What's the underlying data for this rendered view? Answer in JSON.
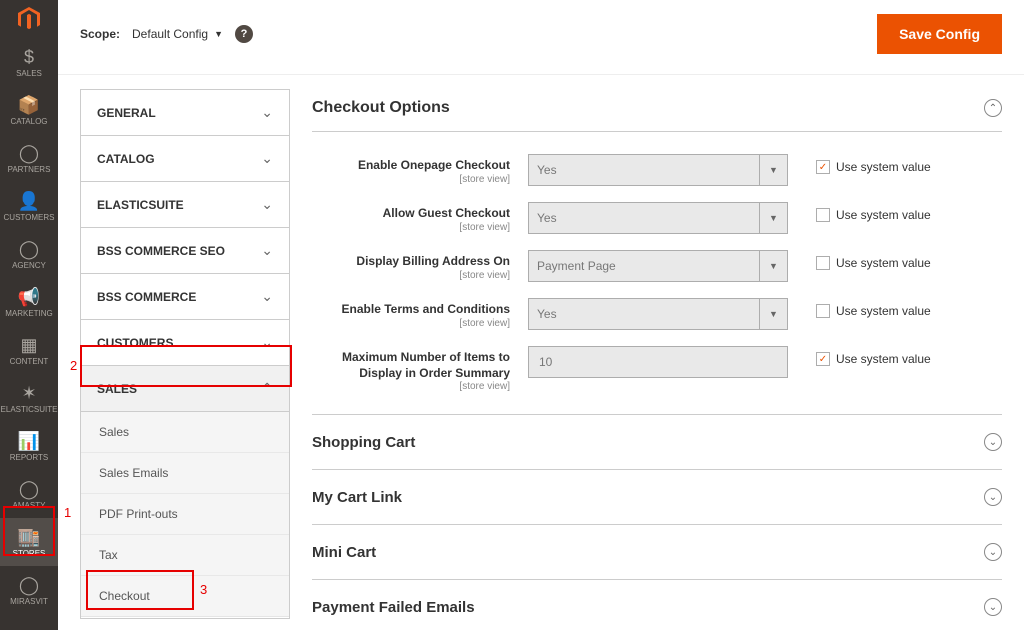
{
  "colors": {
    "accent": "#eb5202",
    "anno": "#e60000"
  },
  "sidebar": {
    "items": [
      {
        "icon": "$",
        "label": "SALES"
      },
      {
        "icon": "📦",
        "label": "CATALOG"
      },
      {
        "icon": "◯",
        "label": "PARTNERS"
      },
      {
        "icon": "👤",
        "label": "CUSTOMERS"
      },
      {
        "icon": "◯",
        "label": "AGENCY"
      },
      {
        "icon": "📢",
        "label": "MARKETING"
      },
      {
        "icon": "▦",
        "label": "CONTENT"
      },
      {
        "icon": "✶",
        "label": "ELASTICSUITE"
      },
      {
        "icon": "📊",
        "label": "REPORTS"
      },
      {
        "icon": "◯",
        "label": "AMASTY"
      },
      {
        "icon": "🏬",
        "label": "STORES"
      },
      {
        "icon": "◯",
        "label": "MIRASVIT"
      }
    ]
  },
  "topbar": {
    "scope_label": "Scope:",
    "scope_value": "Default Config",
    "help_symbol": "?",
    "save_label": "Save Config"
  },
  "nav_sections": [
    {
      "label": "GENERAL",
      "expanded": false
    },
    {
      "label": "CATALOG",
      "expanded": false
    },
    {
      "label": "ELASTICSUITE",
      "expanded": false
    },
    {
      "label": "BSS COMMERCE SEO",
      "expanded": false
    },
    {
      "label": "BSS COMMERCE",
      "expanded": false
    },
    {
      "label": "CUSTOMERS",
      "expanded": false
    },
    {
      "label": "SALES",
      "expanded": true,
      "sub": [
        "Sales",
        "Sales Emails",
        "PDF Print-outs",
        "Tax",
        "Checkout"
      ]
    }
  ],
  "checkout_section_title": "Checkout Options",
  "store_view_label": "[store view]",
  "use_system_label": "Use system value",
  "fields": [
    {
      "label": "Enable Onepage Checkout",
      "value": "Yes",
      "type": "select",
      "inherit": true
    },
    {
      "label": "Allow Guest Checkout",
      "value": "Yes",
      "type": "select",
      "inherit": false
    },
    {
      "label": "Display Billing Address On",
      "value": "Payment Page",
      "type": "select",
      "inherit": false
    },
    {
      "label": "Enable Terms and Conditions",
      "value": "Yes",
      "type": "select",
      "inherit": false
    },
    {
      "label": "Maximum Number of Items to Display in Order Summary",
      "value": "10",
      "type": "input",
      "inherit": true
    }
  ],
  "collapsed_sections": [
    "Shopping Cart",
    "My Cart Link",
    "Mini Cart",
    "Payment Failed Emails"
  ],
  "annotations": {
    "n1": "1",
    "n2": "2",
    "n3": "3"
  }
}
